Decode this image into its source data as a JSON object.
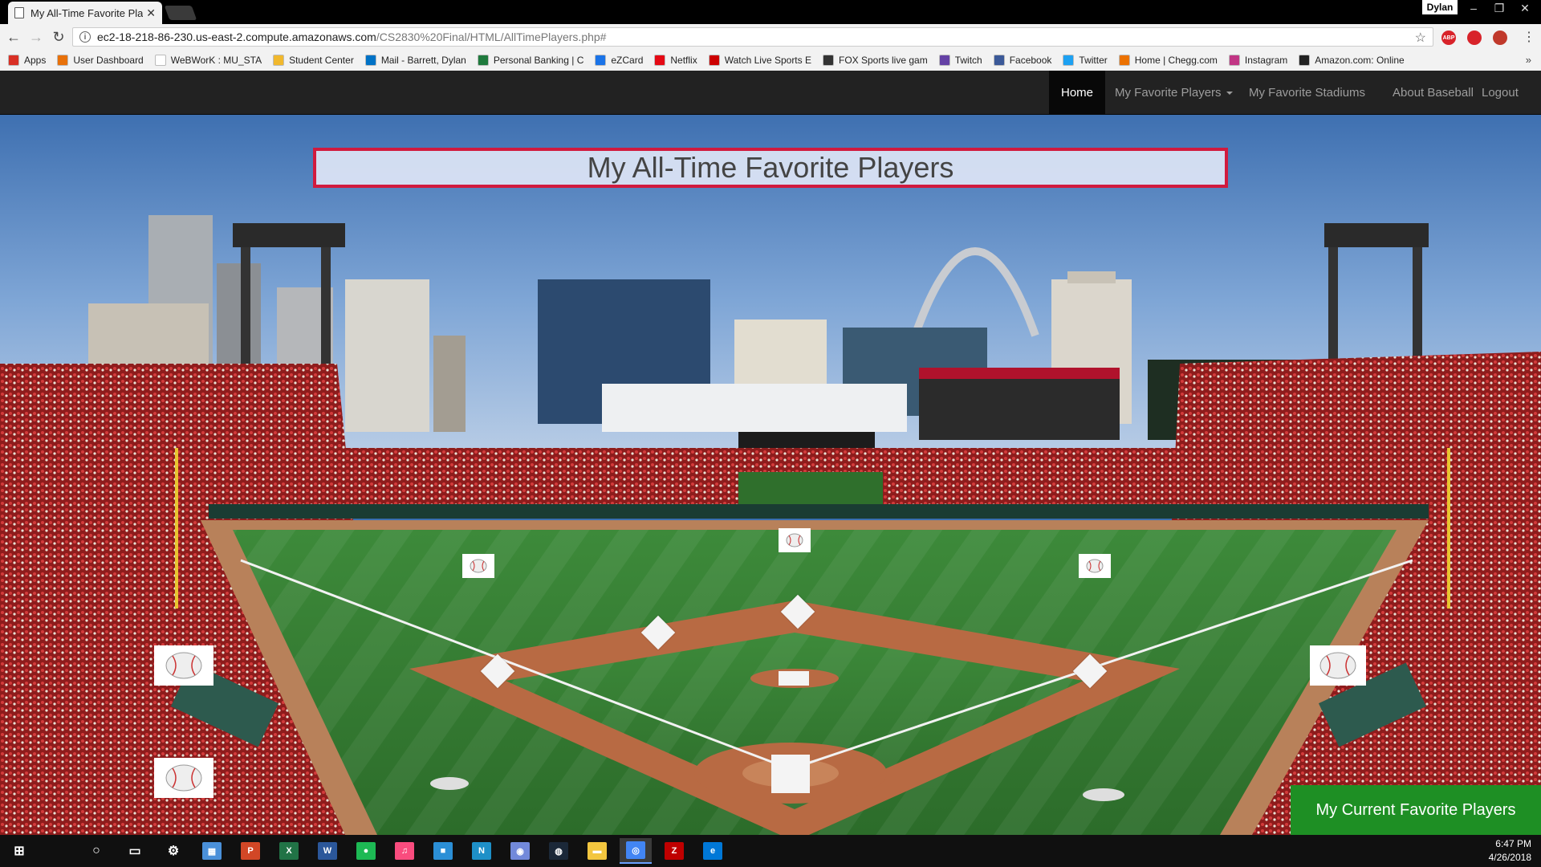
{
  "browser": {
    "tab_title": "My All-Time Favorite Play",
    "profile_name": "Dylan",
    "url_host": "ec2-18-218-86-230.us-east-2.compute.amazonaws.com",
    "url_path": "/CS2830%20Final/HTML/AllTimePlayers.php#",
    "extensions": [
      {
        "icon": "adblock-plus-icon",
        "label": "ABP",
        "color": "#d8232a"
      },
      {
        "icon": "red-circle-extension-icon",
        "label": "",
        "color": "#d8232a"
      },
      {
        "icon": "red-bug-extension-icon",
        "label": "",
        "color": "#c0392b"
      }
    ]
  },
  "bookmarks": [
    {
      "label": "Apps",
      "icon": "apps-grid-icon",
      "color": "#d93025"
    },
    {
      "label": "User Dashboard",
      "icon": "dashboard-icon",
      "color": "#e8710a"
    },
    {
      "label": "WeBWorK : MU_STA",
      "icon": "page-icon",
      "color": "#ffffff"
    },
    {
      "label": "Student Center",
      "icon": "mizzou-icon",
      "color": "#f1b82d"
    },
    {
      "label": "Mail - Barrett, Dylan",
      "icon": "outlook-icon",
      "color": "#0072c6"
    },
    {
      "label": "Personal Banking | C",
      "icon": "bank-icon",
      "color": "#1f7a3d"
    },
    {
      "label": "eZCard",
      "icon": "ezcard-icon",
      "color": "#1a73e8"
    },
    {
      "label": "Netflix",
      "icon": "netflix-icon",
      "color": "#e50914"
    },
    {
      "label": "Watch Live Sports E",
      "icon": "espn-icon",
      "color": "#cc0000"
    },
    {
      "label": "FOX Sports live gam",
      "icon": "fox-sports-icon",
      "color": "#333333"
    },
    {
      "label": "Twitch",
      "icon": "twitch-icon",
      "color": "#6441a5"
    },
    {
      "label": "Facebook",
      "icon": "facebook-icon",
      "color": "#3b5998"
    },
    {
      "label": "Twitter",
      "icon": "twitter-icon",
      "color": "#1da1f2"
    },
    {
      "label": "Home | Chegg.com",
      "icon": "chegg-icon",
      "color": "#eb7100"
    },
    {
      "label": "Instagram",
      "icon": "instagram-icon",
      "color": "#c13584"
    },
    {
      "label": "Amazon.com: Online",
      "icon": "amazon-icon",
      "color": "#222222"
    }
  ],
  "site_nav": {
    "home": "Home",
    "favorite_players": "My Favorite Players",
    "favorite_stadiums": "My Favorite Stadiums",
    "about": "About Baseball",
    "logout": "Logout"
  },
  "page": {
    "title": "My All-Time Favorite Players",
    "current_players_button": "My Current Favorite Players"
  },
  "taskbar": {
    "apps": [
      {
        "icon": "windows-start-icon",
        "color": "#ffffff"
      },
      {
        "icon": "cortana-search-icon",
        "color": "#ffffff"
      },
      {
        "icon": "task-view-icon",
        "color": "#ffffff"
      },
      {
        "icon": "settings-gear-icon",
        "color": "#ffffff"
      },
      {
        "icon": "calculator-icon",
        "color": "#4a90d9"
      },
      {
        "icon": "powerpoint-icon",
        "color": "#d24726"
      },
      {
        "icon": "excel-icon",
        "color": "#217346"
      },
      {
        "icon": "word-icon",
        "color": "#2b579a"
      },
      {
        "icon": "spotify-icon",
        "color": "#1db954"
      },
      {
        "icon": "itunes-icon",
        "color": "#f94c7e"
      },
      {
        "icon": "sticky-app-icon",
        "color": "#2b8fd6"
      },
      {
        "icon": "notes-app-icon",
        "color": "#1e90c8"
      },
      {
        "icon": "discord-icon",
        "color": "#7289da"
      },
      {
        "icon": "steam-icon",
        "color": "#1b2838"
      },
      {
        "icon": "file-explorer-icon",
        "color": "#f3c63f"
      },
      {
        "icon": "chrome-icon",
        "color": "#4285f4"
      },
      {
        "icon": "filezilla-icon",
        "color": "#bf0000"
      },
      {
        "icon": "edge-icon",
        "color": "#0078d7"
      }
    ],
    "time": "6:47 PM",
    "date": "4/26/2018"
  }
}
